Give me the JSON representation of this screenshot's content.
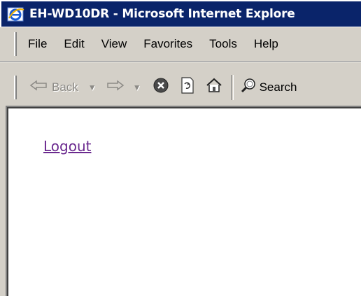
{
  "window": {
    "title": "EH-WD10DR - Microsoft Internet Explore"
  },
  "menubar": {
    "items": [
      "File",
      "Edit",
      "View",
      "Favorites",
      "Tools",
      "Help"
    ]
  },
  "toolbar": {
    "back_label": "Back",
    "search_label": "Search"
  },
  "content": {
    "logout_label": "Logout"
  },
  "colors": {
    "titlebar": "#0a246a",
    "chrome": "#d4d0c8",
    "visited_link": "#6b2a8f"
  },
  "icons": [
    "ie-logo-icon",
    "back-arrow-icon",
    "forward-arrow-icon",
    "stop-icon",
    "refresh-icon",
    "home-icon",
    "search-icon"
  ]
}
